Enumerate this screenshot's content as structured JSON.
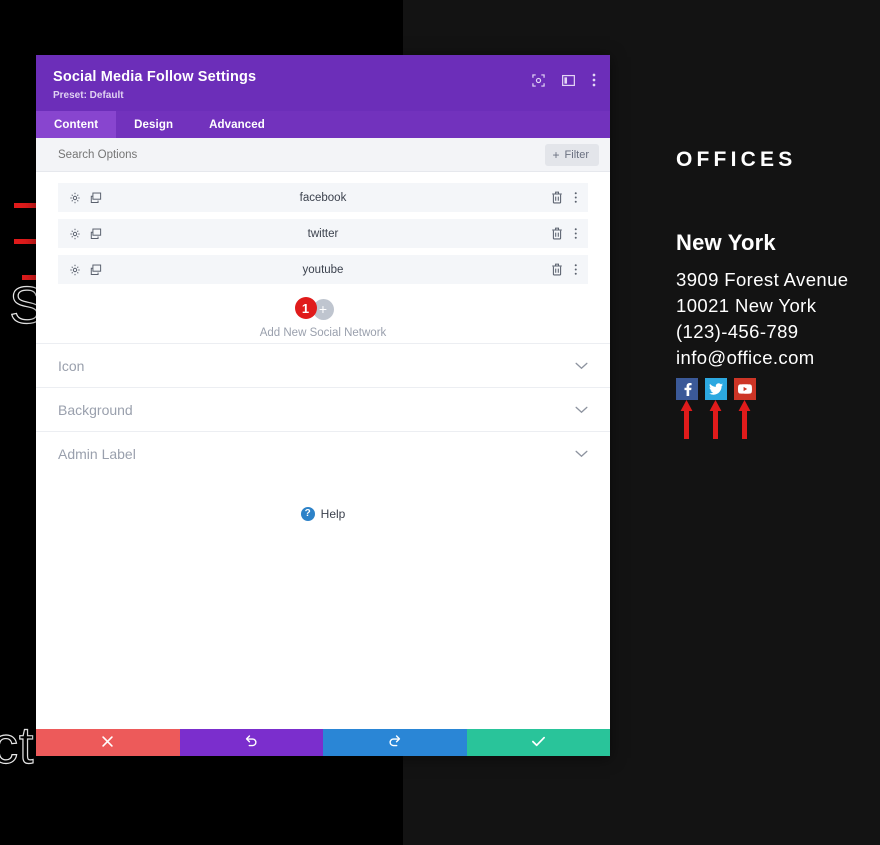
{
  "background_page": {
    "ghost_text_1": "e S",
    "ghost_text_2": "ct",
    "offices": {
      "heading": "OFFICES",
      "city": "New York",
      "address_lines": [
        "3909 Forest Avenue",
        "10021 New York",
        "(123)-456-789",
        "info@office.com"
      ],
      "social_buttons": [
        {
          "name": "facebook",
          "icon": "facebook-icon",
          "color": "#3b5998"
        },
        {
          "name": "twitter",
          "icon": "twitter-icon",
          "color": "#2ca8e0"
        },
        {
          "name": "youtube",
          "icon": "youtube-icon",
          "color": "#cd3526"
        }
      ]
    }
  },
  "annotations": {
    "arrow_color": "#e01b1b",
    "right_arrows_count": 3,
    "up_arrows_count": 3
  },
  "modal": {
    "title": "Social Media Follow Settings",
    "preset": "Preset: Default",
    "header_color": "#6c2eb9",
    "header_icons": [
      {
        "name": "focus-icon",
        "label": "Focus"
      },
      {
        "name": "layout-panel-icon",
        "label": "Layout"
      },
      {
        "name": "more-vertical-icon",
        "label": "More options"
      }
    ],
    "tabs": [
      {
        "label": "Content",
        "active": true
      },
      {
        "label": "Design",
        "active": false
      },
      {
        "label": "Advanced",
        "active": false
      }
    ],
    "search": {
      "placeholder": "Search Options",
      "value": ""
    },
    "filter_button": {
      "label": "Filter",
      "plus": "+"
    },
    "social_networks": [
      {
        "name": "facebook"
      },
      {
        "name": "twitter"
      },
      {
        "name": "youtube"
      }
    ],
    "row_icons": {
      "settings": "gear-icon",
      "duplicate": "duplicate-icon",
      "delete": "trash-icon",
      "more": "more-vertical-icon"
    },
    "add_new": {
      "badge": "1",
      "plus": "+",
      "label": "Add New Social Network"
    },
    "sections": [
      {
        "label": "Icon"
      },
      {
        "label": "Background"
      },
      {
        "label": "Admin Label"
      }
    ],
    "help": {
      "glyph": "?",
      "label": "Help"
    },
    "footer_buttons": [
      {
        "name": "cancel-button",
        "icon": "close-icon",
        "color": "#ed5a5a"
      },
      {
        "name": "undo-button",
        "icon": "undo-icon",
        "color": "#7b2ecd"
      },
      {
        "name": "redo-button",
        "icon": "redo-icon",
        "color": "#2a86d6"
      },
      {
        "name": "save-button",
        "icon": "checkmark-icon",
        "color": "#29c49a"
      }
    ]
  }
}
